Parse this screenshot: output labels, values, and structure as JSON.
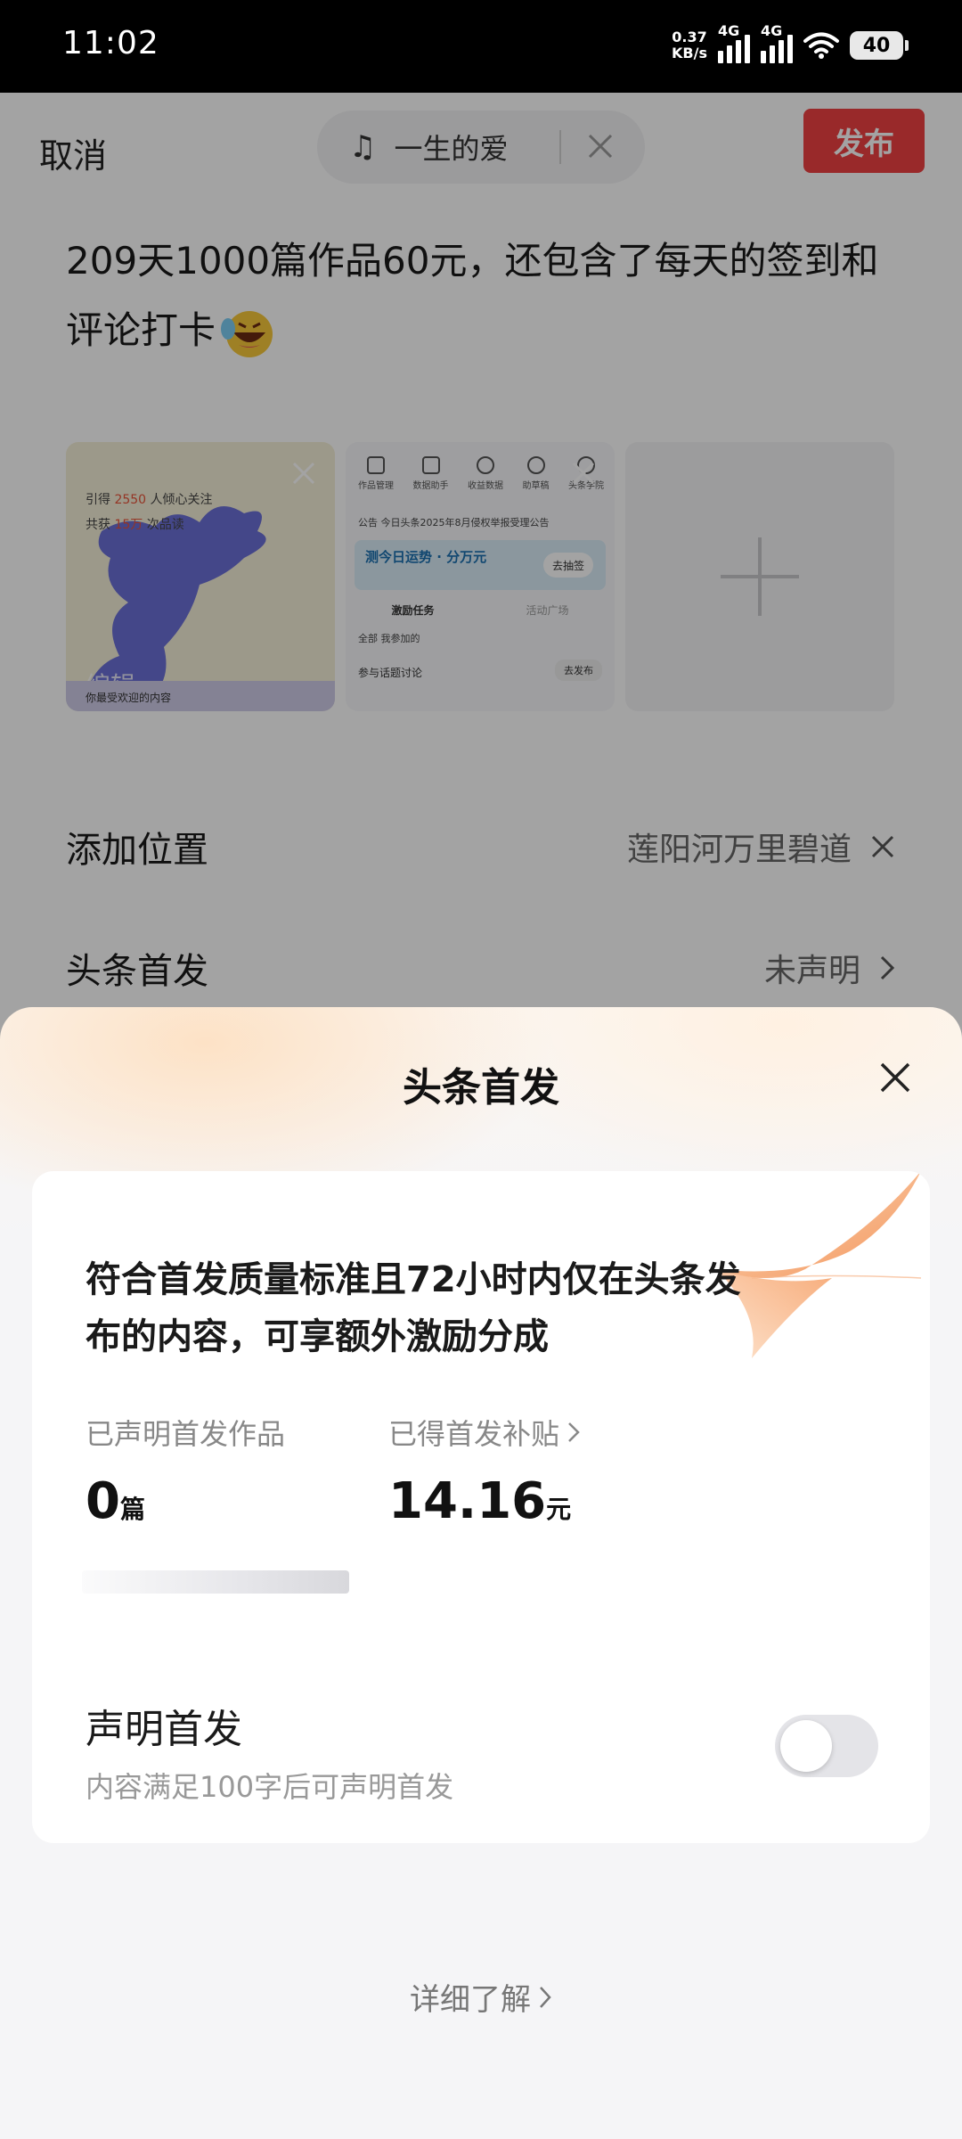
{
  "status_bar": {
    "time": "11:02",
    "net_speed_value": "0.37",
    "net_speed_unit": "KB/s",
    "signal_1_label": "4G",
    "signal_2_label": "4G",
    "battery": "40"
  },
  "composer": {
    "cancel_label": "取消",
    "music_title": "一生的爱",
    "publish_label": "发布",
    "post_text": "209天1000篇作品60元，还包含了每天的签到和评论打卡",
    "emoji_icon": "laughing-crying-emoji-icon",
    "images": [
      {
        "line1_a": "引得",
        "line1_b": "2550",
        "line1_c": "人倾心关注",
        "line2_a": "共获",
        "line2_b": "15万",
        "line2_c": "次品读",
        "edit_label": "编辑",
        "footer": "你最受欢迎的内容"
      },
      {
        "icons": [
          "作品管理",
          "数据助手",
          "收益数据",
          "助草稿",
          "头条学院"
        ],
        "notice": "公告   今日头条2025年8月侵权举报受理公告",
        "banner_title": "测今日运势 · 分万元",
        "banner_btn": "去抽签",
        "tab_1": "激励任务",
        "tab_2": "活动广场",
        "sub": "全部   我参加的",
        "task": "参与话题讨论",
        "task_btn": "去发布"
      }
    ],
    "add_image_icon": "plus-icon",
    "location_label": "添加位置",
    "location_value": "莲阳河万里碧道",
    "first_publish_label": "头条首发",
    "first_publish_value": "未声明"
  },
  "sheet": {
    "title": "头条首发",
    "description": "符合首发质量标准且72小时内仅在头条发布的内容，可享额外激励分成",
    "stats": {
      "declared_caption": "已声明首发作品",
      "declared_value": "0",
      "declared_unit": "篇",
      "subsidy_caption": "已得首发补贴",
      "subsidy_value": "14.16",
      "subsidy_unit": "元"
    },
    "declare_title": "声明首发",
    "declare_subtitle": "内容满足100字后可声明首发",
    "declare_toggle_on": false,
    "learn_more": "详细了解"
  },
  "colors": {
    "publish_red": "#f04142",
    "toggle_off": "#e4e4e8",
    "sheet_warm": "#fde2c6"
  }
}
